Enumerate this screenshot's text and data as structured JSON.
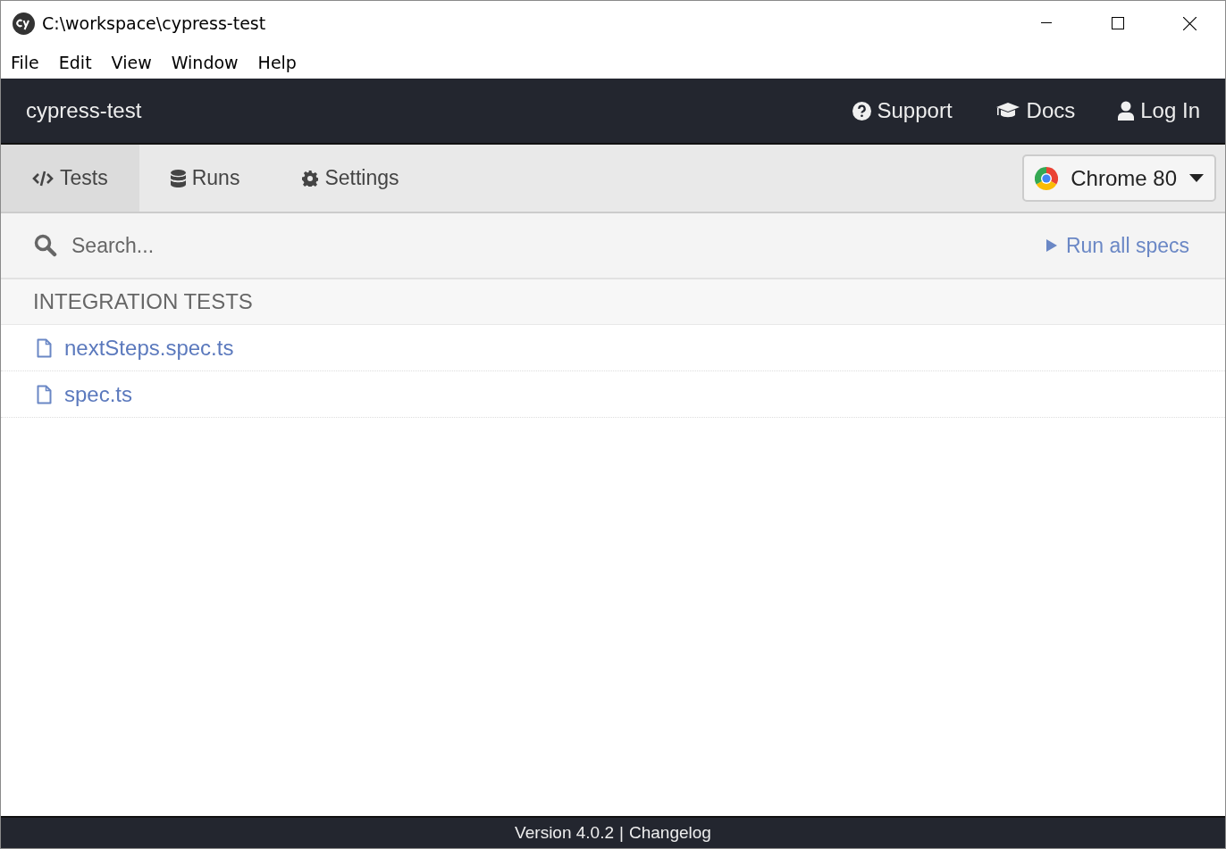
{
  "window": {
    "title": "C:\\workspace\\cypress-test"
  },
  "menu": [
    "File",
    "Edit",
    "View",
    "Window",
    "Help"
  ],
  "nav": {
    "project": "cypress-test",
    "links": [
      {
        "kind": "support",
        "label": "Support"
      },
      {
        "kind": "docs",
        "label": "Docs"
      },
      {
        "kind": "login",
        "label": "Log In"
      }
    ]
  },
  "tabs": [
    {
      "kind": "tests",
      "label": "Tests",
      "selected": true
    },
    {
      "kind": "runs",
      "label": "Runs",
      "selected": false
    },
    {
      "kind": "settings",
      "label": "Settings",
      "selected": false
    }
  ],
  "browser": {
    "label": "Chrome 80"
  },
  "search": {
    "placeholder": "Search..."
  },
  "run_all": "Run all specs",
  "specs": {
    "section": "INTEGRATION TESTS",
    "files": [
      "nextSteps.spec.ts",
      "spec.ts"
    ]
  },
  "footer": {
    "version": "Version 4.0.2",
    "separator": "|",
    "link": "Changelog"
  }
}
